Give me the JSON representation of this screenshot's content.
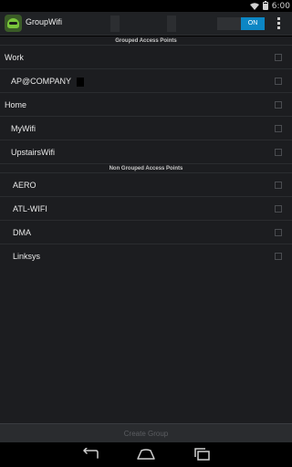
{
  "status_bar": {
    "time": "6:00"
  },
  "app": {
    "title": "GroupWifi",
    "toggle_label": "ON"
  },
  "sections": {
    "grouped_header": "Grouped Access Points",
    "nongrouped_header": "Non Grouped Access Points"
  },
  "grouped": [
    {
      "label": "Work",
      "level": "group"
    },
    {
      "label": "AP@COMPANY",
      "level": "child"
    },
    {
      "label": "Home",
      "level": "group"
    },
    {
      "label": "MyWifi",
      "level": "child"
    },
    {
      "label": "UpstairsWifi",
      "level": "child"
    }
  ],
  "nongrouped": [
    {
      "label": "AERO"
    },
    {
      "label": "ATL-WIFI"
    },
    {
      "label": "DMA"
    },
    {
      "label": "Linksys"
    }
  ],
  "create_button": "Create Group",
  "colors": {
    "accent": "#0c86c4",
    "background": "#1c1d20",
    "action_bar": "#202225"
  }
}
